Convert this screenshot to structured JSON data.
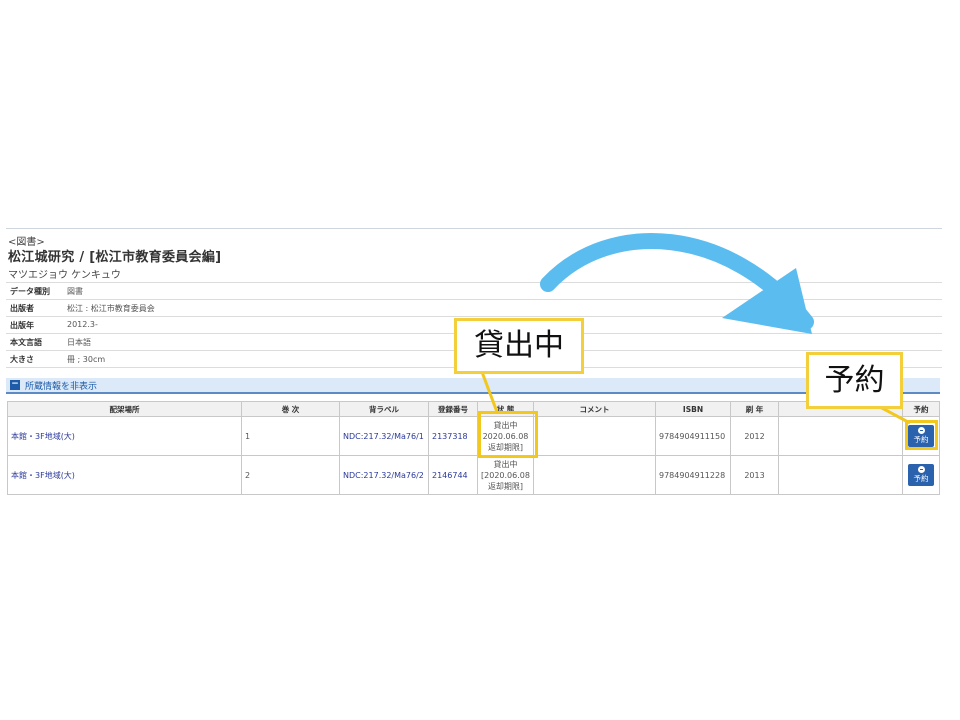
{
  "record": {
    "material_type": "<図書>",
    "title": "松江城研究 / [松江市教育委員会編]",
    "title_kana": "マツエジョウ ケンキュウ"
  },
  "info_rows": [
    {
      "key": "データ種別",
      "value": "図書"
    },
    {
      "key": "出版者",
      "value": "松江 : 松江市教育委員会"
    },
    {
      "key": "出版年",
      "value": "2012.3-"
    },
    {
      "key": "本文言語",
      "value": "日本語"
    },
    {
      "key": "大きさ",
      "value": "冊 ; 30cm"
    }
  ],
  "holdings": {
    "toggle_label": "所蔵情報を非表示",
    "columns": [
      "配架場所",
      "巻 次",
      "背ラベル",
      "登録番号",
      "状 態",
      "コメント",
      "ISBN",
      "刷 年",
      "",
      "予約"
    ],
    "rows": [
      {
        "location": "本館・3F地域(大)",
        "volume": "1",
        "call_number": "NDC:217.32/Ma76/1",
        "reg_no": "2137318",
        "status_1": "貸出中",
        "status_2": "2020.06.08",
        "status_3": "返却期限]",
        "comment": "",
        "isbn": "9784904911150",
        "year": "2012",
        "extra": "",
        "reserve_label": "予約"
      },
      {
        "location": "本館・3F地域(大)",
        "volume": "2",
        "call_number": "NDC:217.32/Ma76/2",
        "reg_no": "2146744",
        "status_1": "貸出中",
        "status_2": "[2020.06.08",
        "status_3": "返却期限]",
        "comment": "",
        "isbn": "9784904911228",
        "year": "2013",
        "extra": "",
        "reserve_label": "予約"
      }
    ]
  },
  "annotations": {
    "status_callout": "貸出中",
    "reserve_callout": "予約",
    "highlight_color": "#f2c81e",
    "arrow_color": "#5bbcf0"
  },
  "icons": [
    "collapse-icon",
    "reserve-icon",
    "curved-arrow-icon"
  ]
}
